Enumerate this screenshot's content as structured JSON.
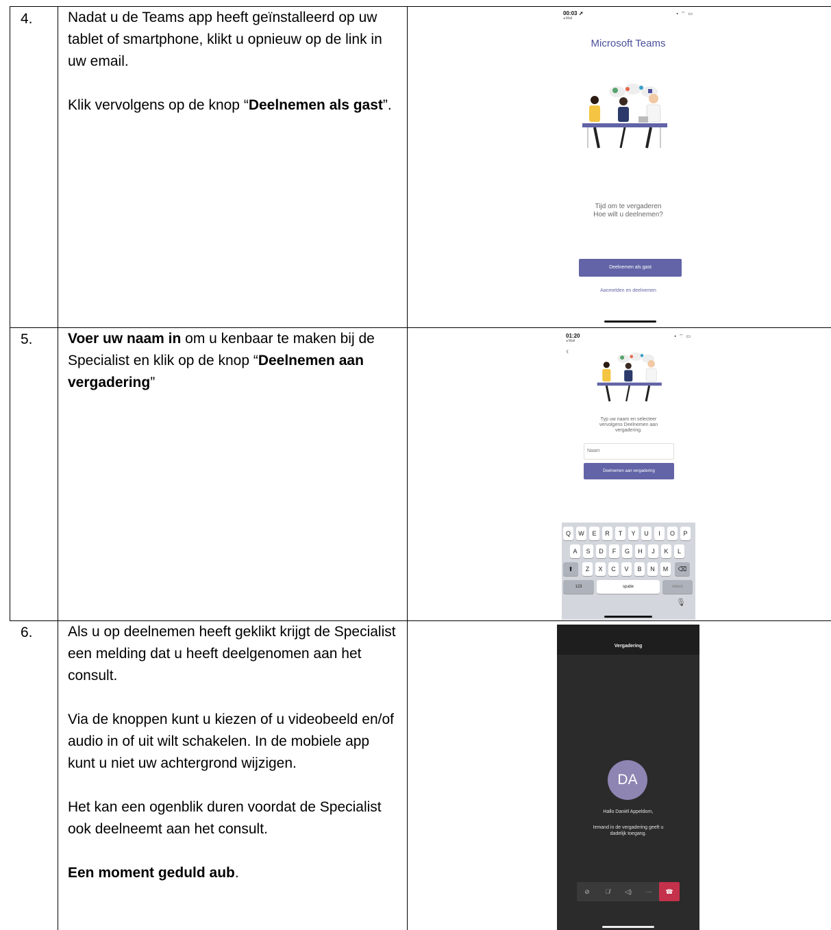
{
  "rows": [
    {
      "number": "4.",
      "paragraphs": [
        [
          {
            "t": "Nadat u de Teams app heeft geïnstalleerd op uw tablet of smartphone, klikt u opnieuw op de link in uw email."
          }
        ],
        [
          {
            "t": "Klik vervolgens op de knop “"
          },
          {
            "t": "Deelnemen als gast",
            "b": true
          },
          {
            "t": "”."
          }
        ]
      ]
    },
    {
      "number": "5.",
      "paragraphs": [
        [
          {
            "t": "Voer uw naam in",
            "b": true
          },
          {
            "t": " om u kenbaar te maken bij de Specialist en klik op de knop “"
          },
          {
            "t": "Deelnemen aan vergadering",
            "b": true
          },
          {
            "t": "”"
          }
        ]
      ]
    },
    {
      "number": "6.",
      "paragraphs": [
        [
          {
            "t": "Als u op deelnemen heeft geklikt krijgt de Specialist een melding dat u heeft deelgenomen aan het consult."
          }
        ],
        [
          {
            "t": "Via de knoppen kunt u kiezen of u videobeeld en/of audio in of uit wilt schakelen. In de mobiele app kunt u niet uw achtergrond wijzigen."
          }
        ],
        [
          {
            "t": "Het kan een ogenblik duren voordat de Specialist ook deelneemt aan het consult."
          }
        ],
        [
          {
            "t": "Een moment geduld aub",
            "b": true
          },
          {
            "t": "."
          }
        ]
      ]
    }
  ],
  "screen1": {
    "time": "00:03",
    "back_app": "◂ Mail",
    "title": "Microsoft Teams",
    "line1": "Tijd om te vergaderen",
    "line2": "Hoe wilt u deelnemen?",
    "guest_button": "Deelnemen als gast",
    "signin_link": "Aanmelden en deelnemen"
  },
  "screen2": {
    "time": "01:20",
    "back_app": "◂ Mail",
    "instruction1": "Typ uw naam en selecteer",
    "instruction2": "vervolgens Deelnemen aan",
    "instruction3": "vergadering.",
    "name_placeholder": "Naam",
    "join_button": "Deelnemen aan vergadering",
    "keyboard": {
      "row1": [
        "Q",
        "W",
        "E",
        "R",
        "T",
        "Y",
        "U",
        "I",
        "O",
        "P"
      ],
      "row2": [
        "A",
        "S",
        "D",
        "F",
        "G",
        "H",
        "J",
        "K",
        "L"
      ],
      "row3": [
        "Z",
        "X",
        "C",
        "V",
        "B",
        "N",
        "M"
      ],
      "numbers_key": "123",
      "space_key": "spatie",
      "return_key": "return"
    }
  },
  "screen3": {
    "header": "Vergadering",
    "initials": "DA",
    "greeting": "Hallo Daniël Appeldorn,",
    "wait1": "Iemand in de vergadering geeft u",
    "wait2": "dadelijk toegang."
  },
  "colors": {
    "teams_purple": "#6264a7",
    "hangup_red": "#c4314b",
    "call_bg": "#2b2b2b",
    "avatar_bg": "#8e85b3"
  }
}
